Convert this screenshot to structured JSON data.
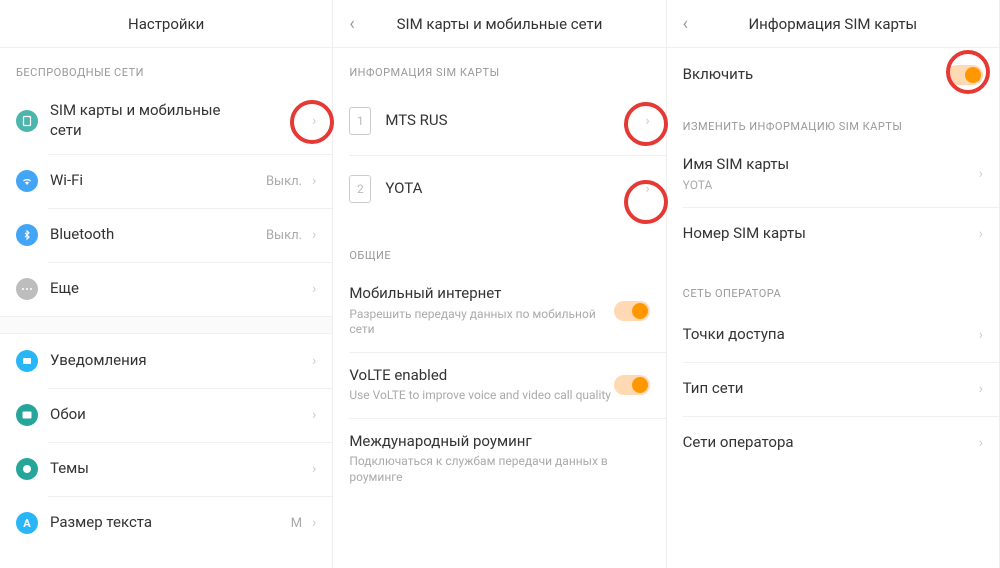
{
  "pane1": {
    "title": "Настройки",
    "section_wireless": "БЕСПРОВОДНЫЕ СЕТИ",
    "items": {
      "sim": "SIM карты и мобильные\nсети",
      "wifi": "Wi-Fi",
      "wifi_value": "Выкл.",
      "bluetooth": "Bluetooth",
      "bluetooth_value": "Выкл.",
      "more": "Еще",
      "notifications": "Уведомления",
      "wallpaper": "Обои",
      "themes": "Темы",
      "textsize": "Размер текста",
      "textsize_value": "M"
    }
  },
  "pane2": {
    "title": "SIM карты и мобильные сети",
    "section_siminfo": "ИНФОРМАЦИЯ SIM КАРТЫ",
    "section_general": "ОБЩИЕ",
    "sims": [
      {
        "num": "1",
        "name": "MTS RUS"
      },
      {
        "num": "2",
        "name": "YOTA"
      }
    ],
    "mobile_data": "Мобильный интернет",
    "mobile_data_sub": "Разрешить передачу данных по мобильной сети",
    "volte": "VoLTE enabled",
    "volte_sub": "Use VoLTE to improve voice and video call quality",
    "roaming": "Международный роуминг",
    "roaming_sub": "Подключаться к службам передачи данных в роуминге"
  },
  "pane3": {
    "title": "Информация SIM карты",
    "enable": "Включить",
    "section_edit": "ИЗМЕНИТЬ ИНФОРМАЦИЮ SIM КАРТЫ",
    "sim_name": "Имя SIM карты",
    "sim_name_value": "YOTA",
    "sim_number": "Номер SIM карты",
    "section_operator": "СЕТЬ ОПЕРАТОРА",
    "apn": "Точки доступа",
    "network_type": "Тип сети",
    "operator_networks": "Сети оператора"
  }
}
